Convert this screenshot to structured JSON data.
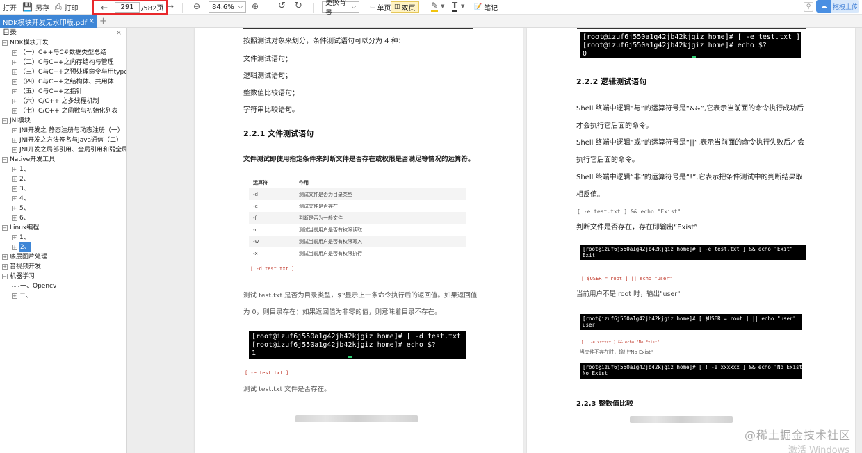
{
  "toolbar": {
    "open": "打开",
    "save_as": "另存",
    "print": "打印",
    "current_page": "291",
    "total_pages": "/582页",
    "zoom": "84.6%",
    "background": "更换背景",
    "single_page": "单页",
    "double_page": "双页",
    "notes": "笔记",
    "upload": "拖拽上传"
  },
  "tabs": [
    {
      "label": "NDK模块开发无水印版.pdf"
    }
  ],
  "sidebar": {
    "title": "目录",
    "items": [
      {
        "label": "NDK模块开发"
      },
      {
        "label": "（一）C++与C#数据类型总结"
      },
      {
        "label": "（二）C与C++之内存结构与管理"
      },
      {
        "label": "（三）C与C++之预处理命令与用typedef"
      },
      {
        "label": "（四）C与C++之结构体、共用体"
      },
      {
        "label": "（五）C与C++之指针"
      },
      {
        "label": "（六）C/C++ 之多线程机制"
      },
      {
        "label": "（七）C/C++ 之函数与初始化列表"
      },
      {
        "label": "JNI模块"
      },
      {
        "label": "JNI开发之 静态注册与动态注册（一）"
      },
      {
        "label": "JNI开发之方法签名与Java通信（二）"
      },
      {
        "label": "JNI开发之局部引用、全局引用和弱全局引用"
      },
      {
        "label": "Native开发工具"
      },
      {
        "label": "1、"
      },
      {
        "label": "2、"
      },
      {
        "label": "3、"
      },
      {
        "label": "4、"
      },
      {
        "label": "5、"
      },
      {
        "label": "6、"
      },
      {
        "label": "Linux编程"
      },
      {
        "label": "1、"
      },
      {
        "label": "2、"
      },
      {
        "label": "底层图片处理"
      },
      {
        "label": "音视频开发"
      },
      {
        "label": "机器学习"
      },
      {
        "label": "一、Opencv"
      },
      {
        "label": "二、"
      }
    ]
  },
  "left_page": {
    "intro": "按照测试对象来划分，条件测试语句可以分为 4 种：",
    "items": [
      "文件测试语句；",
      "逻辑测试语句；",
      "整数值比较语句；",
      "字符串比较语句。"
    ],
    "section_title": "2.2.1  文件测试语句",
    "section_desc": "文件测试即使用指定条件来判断文件是否存在或权限是否满足等情况的运算符。",
    "table_head": [
      "运算符",
      "作用"
    ],
    "table_rows": [
      [
        "-d",
        "测试文件是否为目录类型"
      ],
      [
        "-e",
        "测试文件是否存在"
      ],
      [
        "-f",
        "判断是否为一般文件"
      ],
      [
        "-r",
        "测试当前用户是否有权限读取"
      ],
      [
        "-w",
        "测试当前用户是否有权限写入"
      ],
      [
        "-x",
        "测试当前用户是否有权限执行"
      ]
    ],
    "code1": "[ -d test.txt ]",
    "explain1": "测试 test.txt 是否为目录类型，$?显示上一条命令执行后的返回值。如果返回值",
    "explain2": "为 0，则目录存在；如果返回值为非零的值，则意味着目录不存在。",
    "term1": [
      "[root@izuf6j550a1g42jb42kjgiz home]# [ -d test.txt ]",
      "[root@izuf6j550a1g42jb42kjgiz home]# echo $?",
      "1"
    ],
    "code2": "[ -e test.txt ]",
    "explain3": "测试 test.txt 文件是否存在。"
  },
  "right_page": {
    "term1": [
      "[root@izuf6j550a1g42jb42kjgiz home]# [ -e test.txt ]",
      "[root@izuf6j550a1g42jb42kjgiz home]# echo $?",
      "0"
    ],
    "section_title": "2.2.2  逻辑测试语句",
    "p1a": "Shell 终端中逻辑“与”的运算符号是“&&”,它表示当前面的命令执行成功后",
    "p1b": "才会执行它后面的命令。",
    "p2a": "Shell 终端中逻辑“或”的运算符号是“||”,表示当前面的命令执行失败后才会",
    "p2b": "执行它后面的命令。",
    "p3a": "Shell 终端中逻辑“非”的运算符号是“!”,它表示把条件测试中的判断结果取",
    "p3b": "相反值。",
    "code1": "[ -e test.txt ] && echo \"Exist\"",
    "explain1": "判断文件是否存在，存在即输出“Exist”",
    "term2": [
      "[root@izuf6j550a1g42jb42kjgiz home]# [ -e test.txt ] && echo \"Exit\"",
      "Exit"
    ],
    "code2": "[ $USER = root ] || echo \"user\"",
    "explain2": "当前用户不是 root 时，输出\"user\"",
    "term3": [
      "[root@izuf6j550a1g42jb42kjgiz home]# [ $USER = root ] || echo \"user\"",
      "user"
    ],
    "code3": "[ ! -e xxxxxx ] && echo \"No Exist\"",
    "explain3": "当文件不存在时，输出\"No Exist\"",
    "term4": [
      "[root@izuf6j550a1g42jb42kjgiz home]# [ ! -e xxxxxx ] && echo \"No Exist\"",
      "No Exist"
    ],
    "section3": "2.2.3  整数值比较"
  },
  "watermark": "@稀土掘金技术社区",
  "activate": "激活 Windows"
}
